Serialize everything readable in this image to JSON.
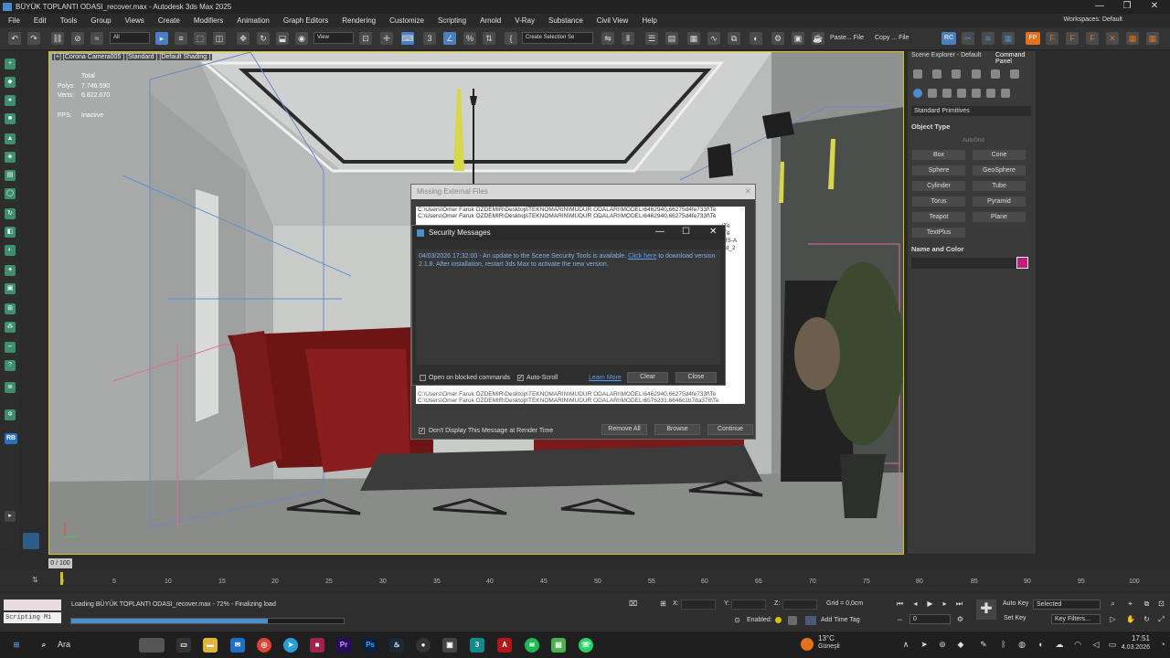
{
  "window": {
    "title": "BÜYÜK TOPLANTI ODASI_recover.max - Autodesk 3ds Max 2025",
    "min": "—",
    "max": "❐",
    "close": "✕"
  },
  "menu": [
    "File",
    "Edit",
    "Tools",
    "Group",
    "Views",
    "Create",
    "Modifiers",
    "Animation",
    "Graph Editors",
    "Rendering",
    "Customize",
    "Scripting",
    "Arnold",
    "V-Ray",
    "Substance",
    "Civil View",
    "Help"
  ],
  "workspace": "Workspaces: Default",
  "toolbar": {
    "filter": "All",
    "refcoord": "View",
    "selset": "Create Selection Se",
    "paste": "Paste... File",
    "copy": "Copy ... File",
    "rc": "RC",
    "fp": "FP"
  },
  "viewport": {
    "label": "[+] [Corona Camera005 ] [Standard ] [Default Shading ]",
    "stats": {
      "total": "Total",
      "polys_label": "Polys:",
      "polys": "7.746.590",
      "verts_label": "Verts:",
      "verts": "6.822.670",
      "fps_label": "FPS:",
      "fps": "Inactive"
    }
  },
  "right_panel": {
    "tab_explorer": "Scene Explorer - Default",
    "tab_command": "Command Panel",
    "dropdown": "Standard Primitives",
    "object_type": "Object Type",
    "autogrid": "AutoGrid",
    "buttons": [
      "Box",
      "Cone",
      "Sphere",
      "GeoSphere",
      "Cylinder",
      "Tube",
      "Torus",
      "Pyramid",
      "Teapot",
      "Plane",
      "TextPlus"
    ],
    "name_color": "Name and Color",
    "swatch_color": "#c21f7a"
  },
  "missing_dialog": {
    "title": "Missing External Files",
    "paths": [
      "C:\\Users\\Ömer Faruk ÖZDEMİR\\Desktop\\TEKNOMARİN\\MÜDÜR ODALARI\\MODEL\\6462940.66275d4fe733f\\Te",
      "C:\\Users\\Ömer Faruk ÖZDEMİR\\Desktop\\TEKNOMARİN\\MÜDÜR ODALARI\\MODEL\\6462940.66275d4fe733f\\Te"
    ],
    "tail_paths": [
      "C:\\Users\\Ömer Faruk ÖZDEMİR\\Desktop\\TEKNOMARİN\\MÜDÜR ODALARI\\MODEL\\6462940.66275d4fe733f\\Te",
      "C:\\Users\\Ömer Faruk ÖZDEMİR\\Desktop\\TEKNOMARİN\\MÜDÜR ODALARI\\MODEL\\6576231.6646c1b7da378\\Te"
    ],
    "side_fragments": [
      "\\Te",
      "\\Te",
      "MS-A",
      "od_2"
    ],
    "dont_display": "Don't Display This Message at Render Time",
    "remove_all": "Remove All",
    "browse": "Browse",
    "continue": "Continue"
  },
  "security_dialog": {
    "title": "Security Messages",
    "msg_a": "04/03/2026 17:32:00 - An update to the Scene Security Tools is available.",
    "link": "Click here",
    "msg_b": "to download",
    "msg_c": "version 2.1.8. After installation, restart 3ds Max to activate the new version.",
    "open_blocked": "Open on blocked commands",
    "auto_scroll": "Auto-Scroll",
    "learn_more": "Learn More",
    "clear": "Clear",
    "close": "Close"
  },
  "timeline": {
    "frame": "0 / 100",
    "ticks": [
      "0",
      "5",
      "10",
      "15",
      "20",
      "25",
      "30",
      "35",
      "40",
      "45",
      "50",
      "55",
      "60",
      "65",
      "70",
      "75",
      "80",
      "85",
      "90",
      "95",
      "100"
    ]
  },
  "status": {
    "maxscript": "Scripting Mi",
    "message": "Loading BÜYÜK TOPLANTI ODASI_recover.max - 72% - Finalizing load",
    "progress": 0.72,
    "x": "X:",
    "y": "Y:",
    "z": "Z:",
    "grid": "Grid = 0,0cm",
    "enabled": "Enabled:",
    "add_time_tag": "Add Time Tag",
    "auto_key": "Auto Key",
    "selected": "Selected",
    "set_key": "Set Key",
    "key_filters": "Key Filters...",
    "frame_value": "0"
  },
  "taskbar": {
    "search": "Ara",
    "temp": "13°C",
    "weather": "Güneşli",
    "time": "17:51",
    "date": "4.03.2026",
    "ps": "Ps",
    "pr": "Pr",
    "arnold_letter": "A",
    "rb": "RB"
  }
}
